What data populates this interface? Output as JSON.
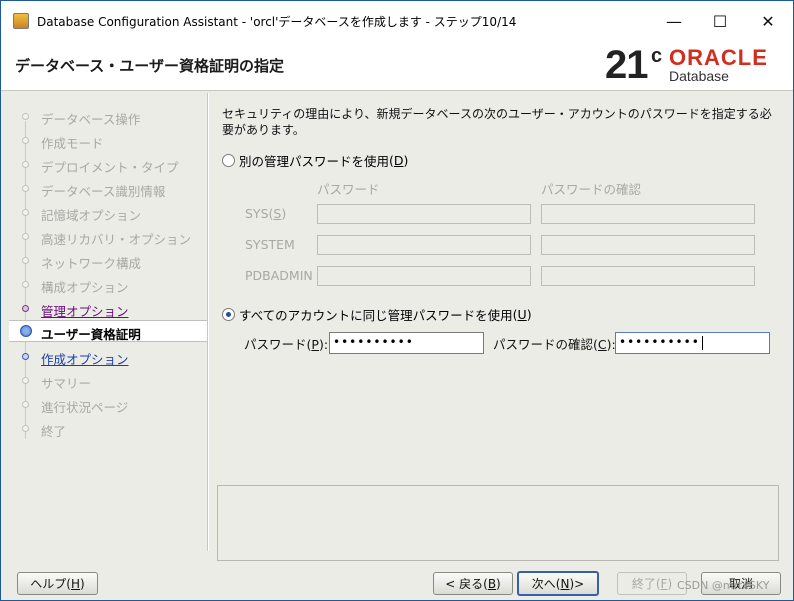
{
  "window": {
    "title": "Database Configuration Assistant - 'orcl'データベースを作成します - ステップ10/14",
    "minimize": "—",
    "maximize": "☐",
    "close": "✕"
  },
  "header": {
    "title": "データベース・ユーザー資格証明の指定",
    "logo_version": "21",
    "logo_sup": "c",
    "logo_brand": "ORACLE",
    "logo_sub": "Database"
  },
  "nav": {
    "items": [
      {
        "label": "データベース操作",
        "state": "done"
      },
      {
        "label": "作成モード",
        "state": "done"
      },
      {
        "label": "デプロイメント・タイプ",
        "state": "done"
      },
      {
        "label": "データベース識別情報",
        "state": "done"
      },
      {
        "label": "記憶域オプション",
        "state": "done"
      },
      {
        "label": "高速リカバリ・オプション",
        "state": "done"
      },
      {
        "label": "ネットワーク構成",
        "state": "done"
      },
      {
        "label": "構成オプション",
        "state": "done"
      },
      {
        "label": "管理オプション",
        "state": "link"
      },
      {
        "label": "ユーザー資格証明",
        "state": "active"
      },
      {
        "label": "作成オプション",
        "state": "next"
      },
      {
        "label": "サマリー",
        "state": "pending"
      },
      {
        "label": "進行状況ページ",
        "state": "pending"
      },
      {
        "label": "終了",
        "state": "pending"
      }
    ]
  },
  "main": {
    "intro": "セキュリティの理由により、新規データベースの次のユーザー・アカウントのパスワードを指定する必要があります。",
    "option_separate": {
      "label": "別の管理パスワードを使用",
      "mnemonic": "D",
      "checked": false
    },
    "separate_table": {
      "col_password": "パスワード",
      "col_confirm": "パスワードの確認",
      "rows": [
        {
          "label": "SYS",
          "mnemonic": "S"
        },
        {
          "label": "SYSTEM"
        },
        {
          "label": "PDBADMIN"
        }
      ]
    },
    "option_same": {
      "label": "すべてのアカウントに同じ管理パスワードを使用",
      "mnemonic": "U",
      "checked": true
    },
    "password_label": "パスワード",
    "password_mnemonic": "P",
    "password_value": "••••••••••",
    "confirm_label": "パスワードの確認",
    "confirm_mnemonic": "C",
    "confirm_value": "••••••••••"
  },
  "buttons": {
    "help": {
      "label": "ヘルプ",
      "mnemonic": "H"
    },
    "back": {
      "label": "< 戻る",
      "mnemonic": "B"
    },
    "next": {
      "label": "次へ",
      "mnemonic": "N",
      "suffix": " >"
    },
    "finish": {
      "label": "終了",
      "mnemonic": "F"
    },
    "cancel": {
      "label": "取消"
    }
  },
  "watermark": "CSDN @mrtxSKY"
}
